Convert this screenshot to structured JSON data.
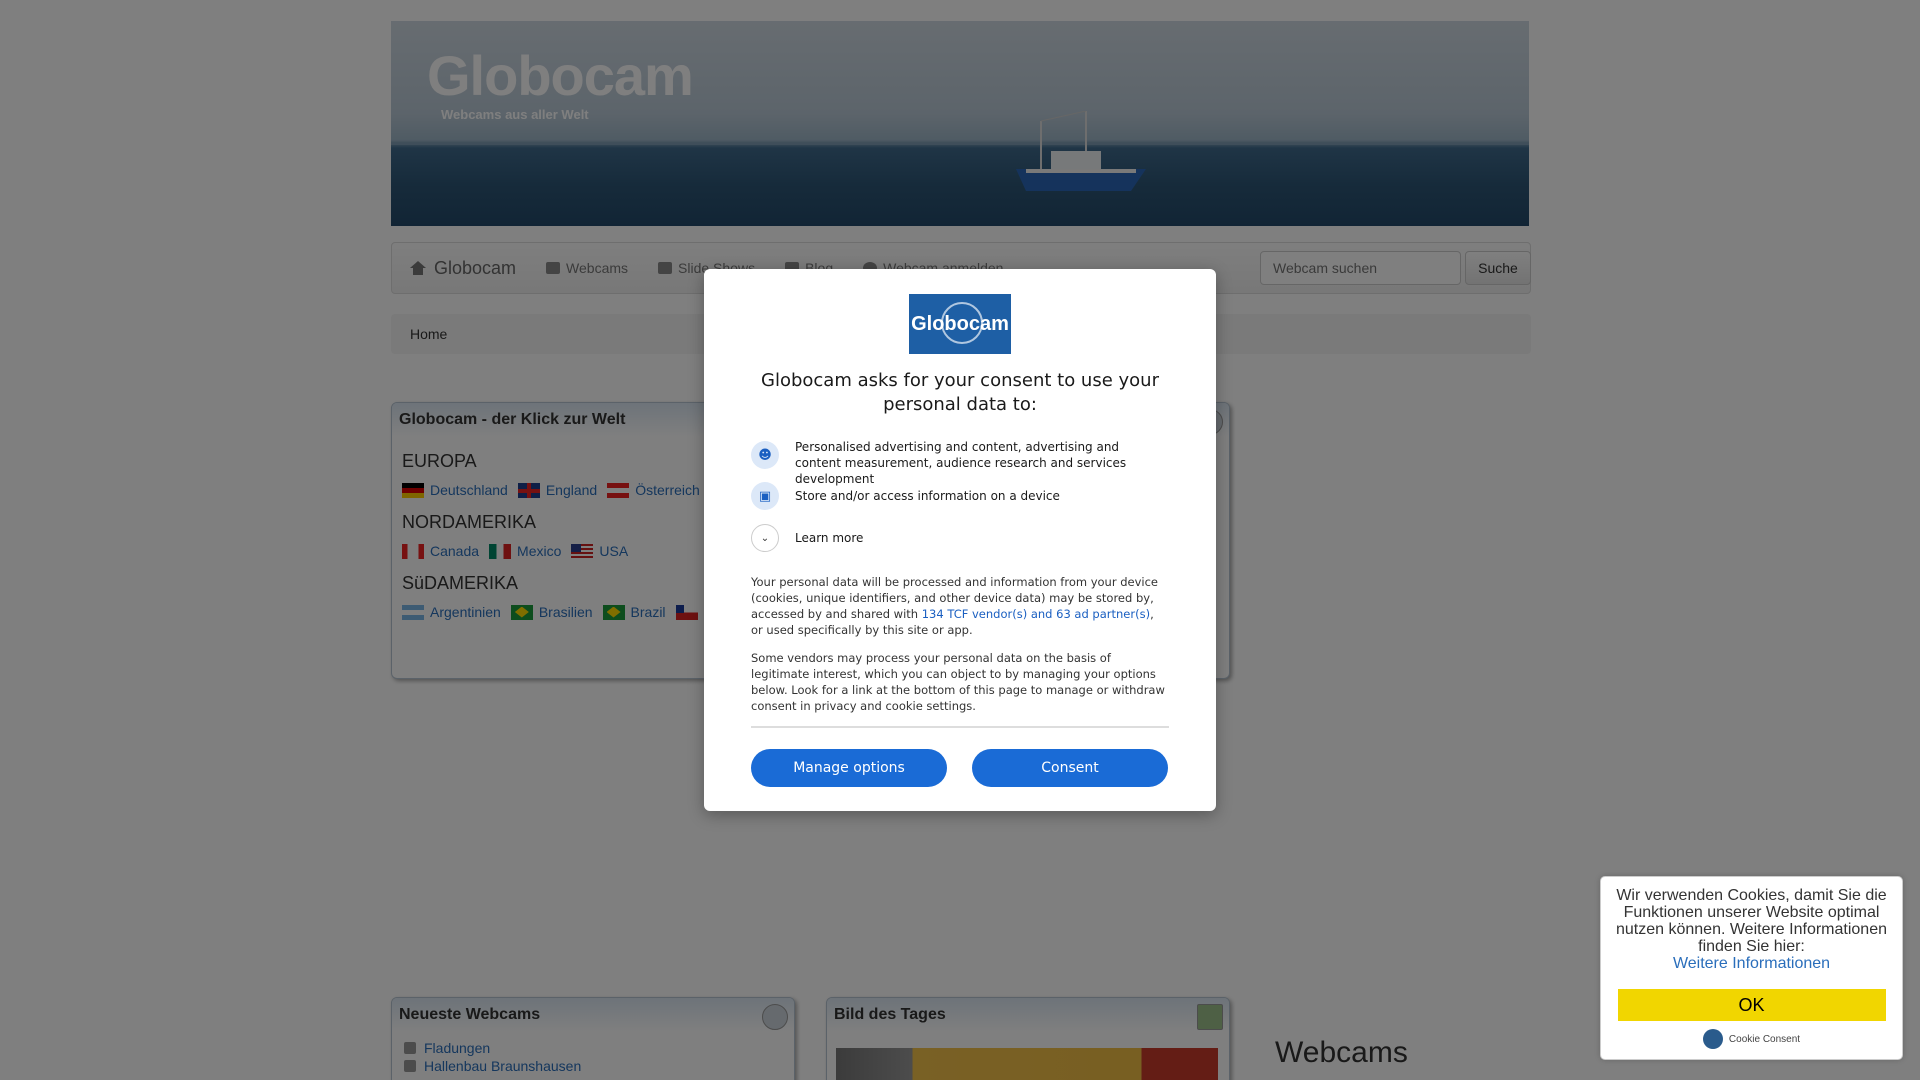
{
  "header": {
    "title": "Globocam",
    "subtitle": "Webcams aus aller Welt"
  },
  "nav": {
    "brand": "Globocam",
    "items": [
      {
        "label": "Webcams",
        "icon": "camera-icon"
      },
      {
        "label": "Slide Shows",
        "icon": "image-icon"
      },
      {
        "label": "Blog",
        "icon": "newspaper-icon"
      },
      {
        "label": "Webcam anmelden",
        "icon": "plus-circle-icon"
      }
    ],
    "search_placeholder": "Webcam suchen",
    "search_button": "Suche"
  },
  "breadcrumb": "Home",
  "world_panel": {
    "title": "Globocam - der Klick zur Welt",
    "continents": [
      {
        "name": "EUROPA",
        "countries": [
          {
            "name": "Deutschland",
            "flag": "de"
          },
          {
            "name": "England",
            "flag": "gb"
          },
          {
            "name": "Österreich",
            "flag": "at"
          }
        ]
      },
      {
        "name": "NORDAMERIKA",
        "countries": [
          {
            "name": "Canada",
            "flag": "ca"
          },
          {
            "name": "Mexico",
            "flag": "mx"
          },
          {
            "name": "USA",
            "flag": "us"
          }
        ]
      },
      {
        "name": "SüDAMERIKA",
        "countries": [
          {
            "name": "Argentinien",
            "flag": "ar"
          },
          {
            "name": "Brasilien",
            "flag": "br"
          },
          {
            "name": "Brazil",
            "flag": "br"
          },
          {
            "name": "",
            "flag": "cl"
          }
        ]
      }
    ]
  },
  "newest_panel": {
    "title": "Neueste Webcams",
    "items": [
      "Fladungen",
      "Hallenbau Braunshausen"
    ]
  },
  "picture_panel": {
    "title": "Bild des Tages"
  },
  "webcams_heading": "Webcams",
  "cookie_banner": {
    "text": "Wir verwenden Cookies, damit Sie die Funktionen unserer Website optimal nutzen können. Weitere Informationen finden Sie hier:",
    "link": "Weitere Informationen",
    "ok": "OK",
    "brand": "Cookie Consent"
  },
  "consent_modal": {
    "logo_text": "Globocam",
    "title": "Globocam asks for your consent to use your personal data to:",
    "purposes": [
      {
        "icon": "person-icon",
        "text": "Personalised advertising and content, advertising and content measurement, audience research and services development"
      },
      {
        "icon": "device-icon",
        "text": "Store and/or access information on a device"
      }
    ],
    "learn_more": "Learn more",
    "para1_before": "Your personal data will be processed and information from your device (cookies, unique identifiers, and other device data) may be stored by, accessed by and shared with ",
    "para1_link": "134 TCF vendor(s) and 63 ad partner(s)",
    "para1_after": ", or used specifically by this site or app.",
    "para2": "Some vendors may process your personal data on the basis of legitimate interest, which you can object to by managing your options below. Look for a link at the bottom of this page to manage or withdraw consent in privacy and cookie settings.",
    "manage_button": "Manage options",
    "consent_button": "Consent"
  },
  "colors": {
    "link": "#2a6ebb",
    "modal_button": "#1a6bd6",
    "cookie_ok": "#f1d600",
    "logo_blue": "#1e5fa5"
  }
}
